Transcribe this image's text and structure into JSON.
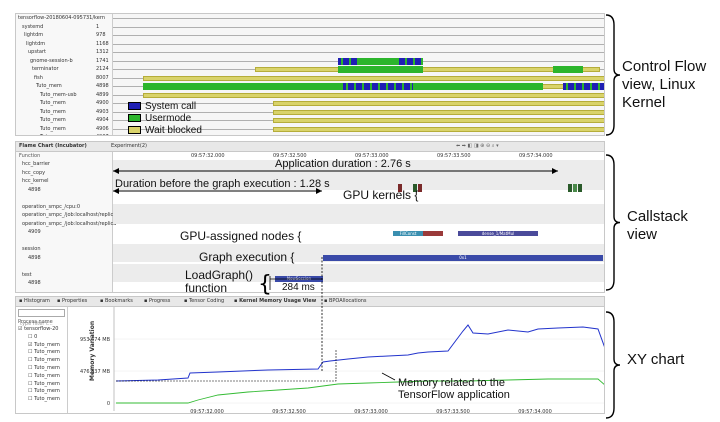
{
  "control_flow": {
    "rows": [
      {
        "name": "tensorflow-20180604-095731/kern",
        "tid": ""
      },
      {
        "name": "systemd",
        "tid": "1"
      },
      {
        "name": "lightdm",
        "tid": "978"
      },
      {
        "name": "lightdm",
        "tid": "1168"
      },
      {
        "name": "upstart",
        "tid": "1312"
      },
      {
        "name": "gnome-session-b",
        "tid": "1741"
      },
      {
        "name": "terminator",
        "tid": "2124"
      },
      {
        "name": "fish",
        "tid": "8007"
      },
      {
        "name": "Tuto_mem",
        "tid": "4898"
      },
      {
        "name": "Tuto_mem-usb",
        "tid": "4899"
      },
      {
        "name": "Tuto_mem",
        "tid": "4900"
      },
      {
        "name": "Tuto_mem",
        "tid": "4903"
      },
      {
        "name": "Tuto_mem",
        "tid": "4904"
      },
      {
        "name": "Tuto_mem",
        "tid": "4906"
      },
      {
        "name": "Tuto_mem",
        "tid": "4907"
      }
    ],
    "legend": [
      {
        "label": "System call",
        "color": "#1f1fb4"
      },
      {
        "label": "Usermode",
        "color": "#2cb52c"
      },
      {
        "label": "Wait blocked",
        "color": "#d9d36a"
      }
    ]
  },
  "flame_chart": {
    "tabs": [
      "Flame Chart (Incubator)",
      "Experiment(2)"
    ],
    "column_header": "Function",
    "time_ticks": [
      "09:57:32.000",
      "09:57:32.500",
      "09:57:33.000",
      "09:57:33.500",
      "09:57:34.000"
    ],
    "rows": [
      "hcc_barrier",
      "hcc_copy",
      "hcc_kernel",
      "4898",
      "",
      "operation_smpc_/cpu:0",
      "operation_smpc_/job:localhost/replica",
      "operation_smpc_/job:localhost/replica",
      "4909",
      "",
      "session",
      "4898",
      "",
      "test",
      "4898"
    ],
    "bars": {
      "fill_constant": "FillConst",
      "dense": "dense_1/MatMul",
      "ox": "0x1",
      "new_session": "NewSession"
    }
  },
  "annotations": {
    "app_duration": "Application duration : 2.76 s",
    "duration_before": "Duration before the graph execution : 1.28 s",
    "gpu_kernels": "GPU kernels {",
    "gpu_nodes": "GPU-assigned nodes   {",
    "graph_exec": "Graph execution   {",
    "loadgraph_1": "LoadGraph()",
    "loadgraph_2": "function",
    "ms": "284 ms",
    "memory_1": "Memory related to the",
    "memory_2": "TensorFlow application"
  },
  "xy_chart": {
    "tabs": [
      "Histogram",
      "Properties",
      "Bookmarks",
      "Progress",
      "Tensor Coding",
      "Kernel Memory Usage View",
      "BPOAllocations"
    ],
    "filter_placeholder": "type filter t...",
    "column_header": "Process name",
    "tree": [
      "tensorflow-20",
      "0",
      "Tuto_mem",
      "Tuto_mem",
      "Tuto_mem",
      "Tuto_mem",
      "Tuto_mem",
      "Tuto_mem",
      "Tuto_mem",
      "Tuto_mem"
    ],
    "checked": [
      true,
      false,
      true,
      false,
      false,
      false,
      false,
      false,
      false,
      false
    ],
    "y_axis_label": "Memory Variation",
    "y_ticks": [
      "953.674 MB",
      "476.837 MB",
      "0"
    ],
    "time_ticks": [
      "09:57:32.000",
      "09:57:32.500",
      "09:57:33.000",
      "09:57:33.500",
      "09:57:34.000"
    ]
  },
  "section_labels": {
    "control_flow": [
      "Control Flow",
      "view, Linux",
      "Kernel"
    ],
    "callstack": [
      "Callstack",
      "view"
    ],
    "xy": [
      "XY chart"
    ]
  }
}
